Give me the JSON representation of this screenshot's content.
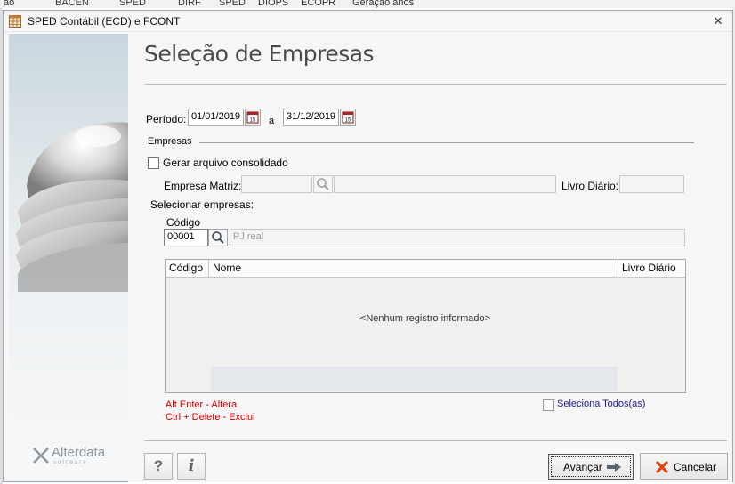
{
  "background_tabs": [
    "ão",
    "BACEN",
    "SPED",
    "DIRF",
    "SPED",
    "DIOPS",
    "ECOPR",
    "Geração anos"
  ],
  "window": {
    "title": "SPED Contábil (ECD) e FCONT",
    "close_glyph": "✕"
  },
  "page": {
    "title": "Seleção de Empresas"
  },
  "periodo": {
    "label": "Período:",
    "start": "01/01/2019",
    "separator": "a",
    "end": "31/12/2019"
  },
  "empresas": {
    "section_label": "Empresas",
    "consolidado_label": "Gerar arquivo consolidado",
    "consolidado_checked": false,
    "matriz_label": "Empresa Matriz:",
    "matriz_code": "",
    "matriz_name": "",
    "livro_label": "Livro Diário:",
    "livro_value": ""
  },
  "selecionar": {
    "label": "Selecionar empresas:",
    "codigo_label": "Código",
    "codigo_value": "00001",
    "nome_placeholder": "PJ real"
  },
  "grid": {
    "columns": [
      "Código",
      "Nome",
      "Livro Diário"
    ],
    "rows": [],
    "empty_text": "<Nenhum registro informado>"
  },
  "hints": {
    "line1": "Alt Enter - Altera",
    "line2": "Ctrl + Delete - Exclui"
  },
  "select_all": {
    "label": "Seleciona Todos(as)",
    "checked": false
  },
  "buttons": {
    "help": "?",
    "info": "i",
    "next": "Avançar",
    "cancel": "Cancelar"
  },
  "brand": {
    "name": "Alterdata",
    "sub": "software"
  },
  "colors": {
    "hint_red": "#d40000",
    "link_blue": "#1a1aa0",
    "cancel_icon": "#d9480f",
    "arrow_icon": "#5a6470"
  }
}
